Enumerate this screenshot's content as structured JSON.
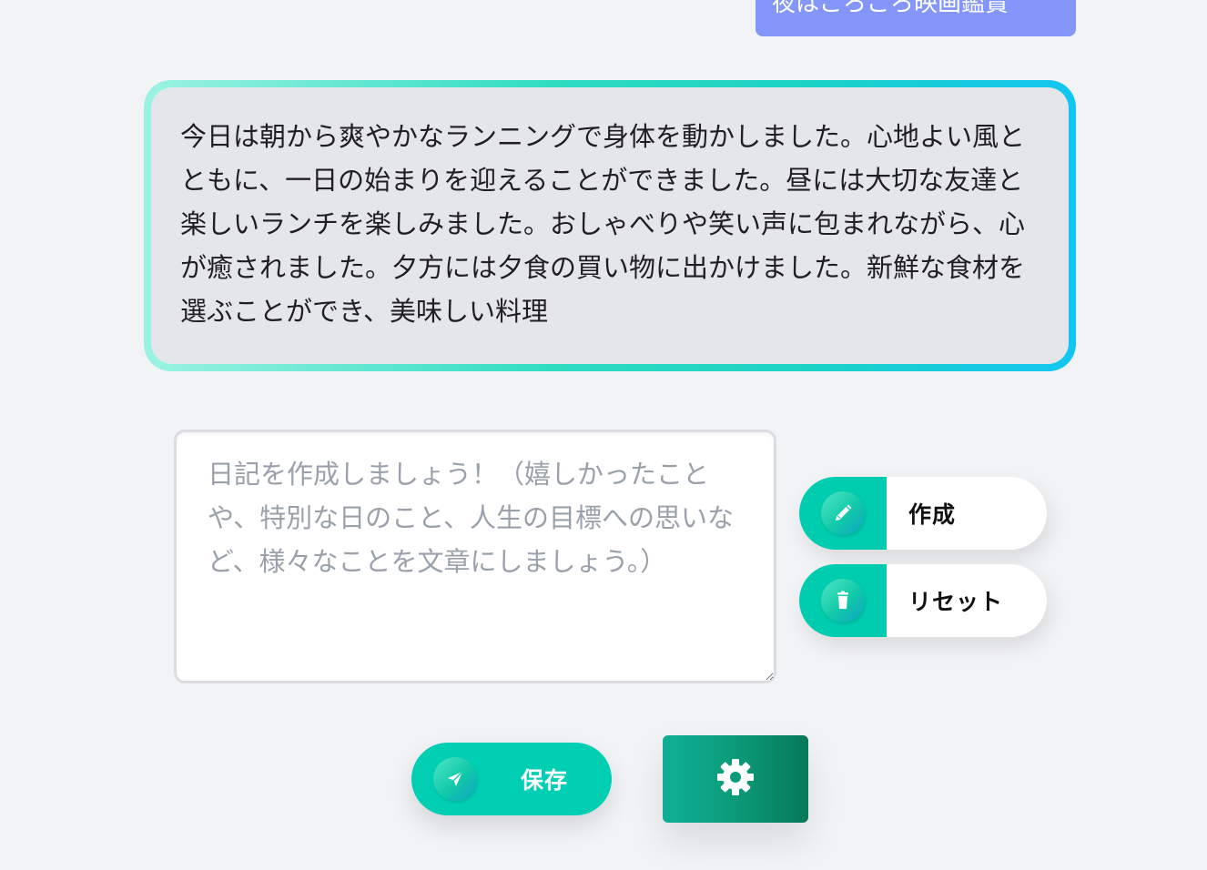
{
  "chat": {
    "user_message": "夜はごろごろ映画鑑賞",
    "generated_diary": "今日は朝から爽やかなランニングで身体を動かしました。心地よい風とともに、一日の始まりを迎えることができました。昼には大切な友達と楽しいランチを楽しみました。おしゃべりや笑い声に包まれながら、心が癒されました。夕方には夕食の買い物に出かけました。新鮮な食材を選ぶことができ、美味しい料理"
  },
  "input": {
    "value": "",
    "placeholder": "日記を作成しましょう！（嬉しかったことや、特別な日のこと、人生の目標への思いなど、様々なことを文章にしましょう。）"
  },
  "actions": {
    "create_label": "作成",
    "create_icon": "pencil-icon",
    "reset_label": "リセット",
    "reset_icon": "trash-icon",
    "save_label": "保存",
    "save_icon": "send-icon",
    "settings_icon": "gear-icon"
  },
  "colors": {
    "page_background": "#f2f3f5",
    "user_bubble": "#8496f8",
    "accent_teal": "#00ccb0",
    "settings_green": "#0c9a78",
    "output_background": "#e5e6ea"
  }
}
